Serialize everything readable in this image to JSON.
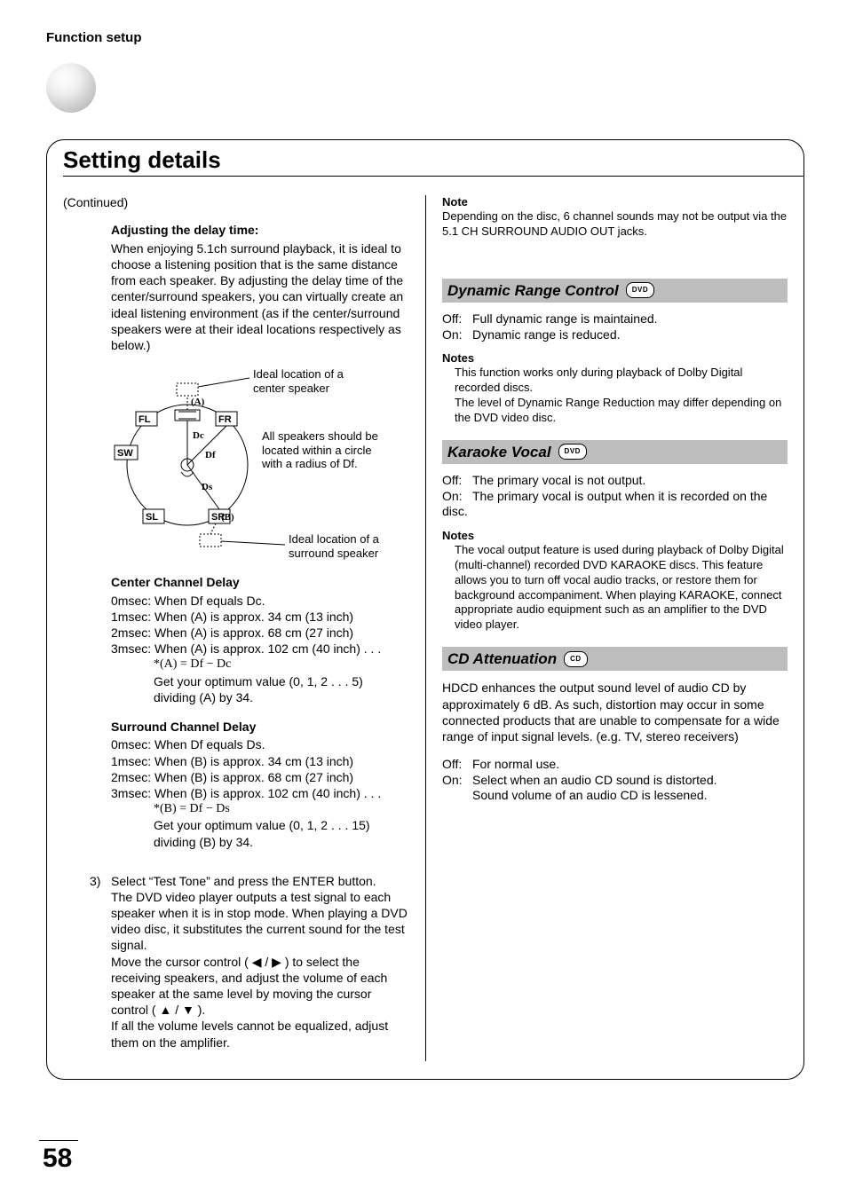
{
  "header": "Function setup",
  "title": "Setting details",
  "page_number": "58",
  "left": {
    "continued": "(Continued)",
    "adjust_h": "Adjusting the delay time:",
    "adjust_p": "When enjoying 5.1ch surround playback, it is ideal to choose a listening position that is the same distance from each speaker. By adjusting the delay time of the center/surround speakers, you can virtually create an ideal listening environment (as if the center/surround speakers were at their ideal locations respectively as below.)",
    "diagram": {
      "ideal_center": "Ideal location of a center speaker",
      "radius_note": "All speakers should be located within a circle with a radius of Df.",
      "ideal_surround": "Ideal location of a surround speaker",
      "labels": {
        "FL": "FL",
        "FR": "FR",
        "SW": "SW",
        "SL": "SL",
        "SR": "SR",
        "A": "(A)",
        "B": "(B)",
        "Dc": "Dc",
        "Df": "Df",
        "Ds": "Ds"
      }
    },
    "center_delay_h": "Center Channel Delay",
    "center_delay_lines": [
      "0msec: When Df equals Dc.",
      "1msec: When (A) is approx. 34 cm (13 inch)",
      "2msec: When (A) is approx. 68 cm (27 inch)",
      "3msec: When (A) is approx. 102 cm (40 inch) . . ."
    ],
    "center_delay_formula": "*(A) = Df − Dc",
    "center_delay_tail1": "Get your optimum value (0, 1, 2 . . . 5)",
    "center_delay_tail2": "dividing (A) by 34.",
    "surround_delay_h": "Surround Channel Delay",
    "surround_delay_lines": [
      "0msec: When Df equals Ds.",
      "1msec: When (B) is approx. 34 cm (13 inch)",
      "2msec: When (B) is approx. 68 cm (27 inch)",
      "3msec: When (B) is approx. 102 cm (40 inch) . . ."
    ],
    "surround_delay_formula": "*(B) = Df − Ds",
    "surround_delay_tail1": "Get your optimum value (0, 1, 2 . . . 15)",
    "surround_delay_tail2": "dividing (B) by 34.",
    "step3_num": "3)",
    "step3_l1": "Select “Test Tone” and press the ENTER button.",
    "step3_l2": "The DVD video player outputs a test signal to each speaker when it is in stop mode. When playing a DVD video disc, it substitutes the current sound for the test signal.",
    "step3_l3": "Move the cursor control ( ◀ / ▶ ) to select the receiving speakers, and adjust the volume of each speaker at the same level by moving the cursor control ( ▲ / ▼ ).",
    "step3_l4": "If all the volume levels cannot be equalized, adjust them on the amplifier."
  },
  "right": {
    "note_h": "Note",
    "note_body": "Depending on the disc, 6 channel sounds may not be output via the 5.1 CH SURROUND AUDIO OUT jacks.",
    "drc_h": "Dynamic Range Control",
    "drc_badge": "DVD",
    "drc_off": "Full dynamic range is maintained.",
    "drc_on": "Dynamic range is reduced.",
    "drc_notes_h": "Notes",
    "drc_n1": "This function works only during playback of Dolby Digital recorded discs.",
    "drc_n2": "The level of Dynamic Range Reduction may differ depending on the DVD video disc.",
    "kv_h": "Karaoke Vocal",
    "kv_badge": "DVD",
    "kv_off": "The primary vocal is not output.",
    "kv_on": "The primary vocal is output when it is recorded on the disc.",
    "kv_notes_h": "Notes",
    "kv_n1": "The vocal output feature is used during playback of Dolby Digital (multi-channel) recorded DVD KARAOKE discs. This feature allows you to turn off vocal audio tracks, or restore them for background accompaniment. When playing KARAOKE, connect appropriate audio equipment such as an amplifier to the DVD video player.",
    "cd_h": "CD Attenuation",
    "cd_badge": "CD",
    "cd_p": "HDCD enhances the output sound level of audio CD by approximately 6 dB.  As such, distortion may occur in some connected products that are unable to compensate for a wide range of input signal levels. (e.g. TV, stereo receivers)",
    "cd_off": "For normal use.",
    "cd_on1": "Select when an audio CD sound is distorted.",
    "cd_on2": "Sound volume of an audio CD is lessened.",
    "off_label": "Off:",
    "on_label": "On:"
  }
}
